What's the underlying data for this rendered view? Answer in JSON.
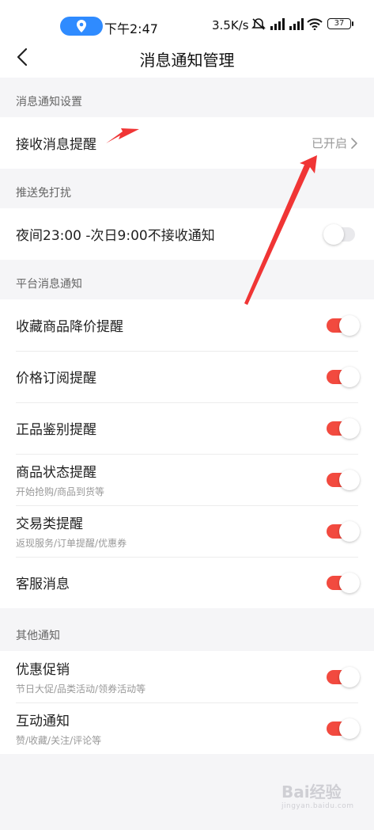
{
  "status_bar": {
    "time": "下午2:47",
    "net_speed": "3.5K/s",
    "battery": "37"
  },
  "nav": {
    "title": "消息通知管理"
  },
  "sections": {
    "notify_settings": {
      "header": "消息通知设置",
      "receive_label": "接收消息提醒",
      "receive_value": "已开启"
    },
    "dnd": {
      "header": "推送免打扰",
      "night_label": "夜间23:00 -次日9:00不接收通知",
      "night_on": false
    },
    "platform": {
      "header": "平台消息通知",
      "items": [
        {
          "title": "收藏商品降价提醒",
          "subtitle": "",
          "on": true
        },
        {
          "title": "价格订阅提醒",
          "subtitle": "",
          "on": true
        },
        {
          "title": "正品鉴别提醒",
          "subtitle": "",
          "on": true
        },
        {
          "title": "商品状态提醒",
          "subtitle": "开始抢购/商品到货等",
          "on": true
        },
        {
          "title": "交易类提醒",
          "subtitle": "返现服务/订单提醒/优惠券",
          "on": true
        },
        {
          "title": "客服消息",
          "subtitle": "",
          "on": true
        }
      ]
    },
    "other": {
      "header": "其他通知",
      "items": [
        {
          "title": "优惠促销",
          "subtitle": "节日大促/品类活动/领券活动等",
          "on": true
        },
        {
          "title": "互动通知",
          "subtitle": "赞/收藏/关注/评论等",
          "on": true
        }
      ]
    }
  },
  "watermark": {
    "text": "Bai经验",
    "sub": "jingyan.baidu.com"
  },
  "colors": {
    "toggle_on": "#f24a3f",
    "toggle_off": "#e9e9ec",
    "annotation_arrow": "#f03535",
    "location_pill": "#2f8bff"
  }
}
